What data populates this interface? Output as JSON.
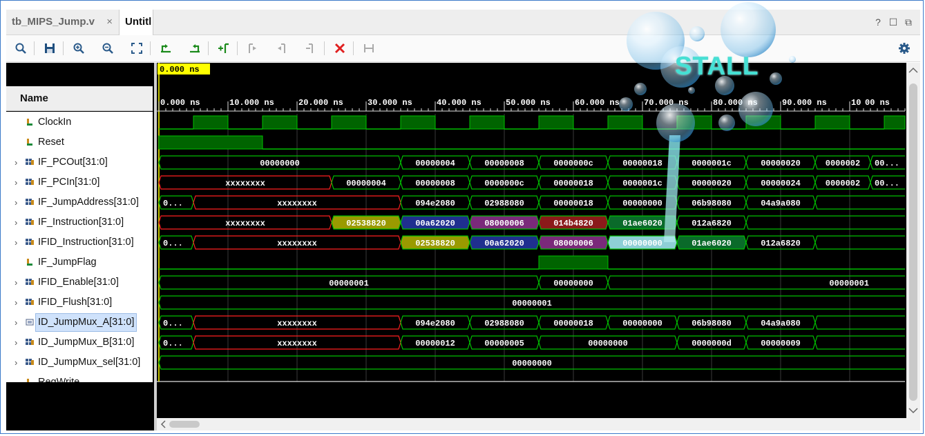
{
  "tabs": [
    {
      "label": "tb_MIPS_Jump.v",
      "close": "×"
    },
    {
      "label": "Untitl"
    }
  ],
  "window_buttons": [
    "?",
    "☐",
    "⧉"
  ],
  "toolbar": {
    "icons": [
      "search-icon",
      "save-icon",
      "zoom-in-icon",
      "zoom-out-icon",
      "zoom-fit-icon",
      "go-to-cursor-left-icon",
      "go-to-cursor-right-icon",
      "add-marker-icon",
      "previous-transition-icon",
      "next-transition-icon",
      "add-cursor-icon",
      "delete-icon",
      "swap-cursors-icon",
      "settings-icon"
    ]
  },
  "name_header": "Name",
  "cursor_time": "0.000 ns",
  "timescale": [
    "0.000 ns",
    "10.000 ns",
    "20.000 ns",
    "30.000 ns",
    "40.000 ns",
    "50.000 ns",
    "60.000 ns",
    "70.000 ns",
    "80.000 ns",
    "90.000 ns",
    "10",
    "00 ns"
  ],
  "overlay_text": "STALL",
  "colors": {
    "wave_green": "#00c000",
    "clock_fill": "#006400",
    "x_red": "#ff2020",
    "yellow": "#9a9a00",
    "blue": "#1f2f8f",
    "purple": "#7a2a7a",
    "red": "#8b1a1a",
    "green_bus": "#0a6a2a",
    "cyan": "#8ecfd6",
    "background": "#000000",
    "cursor_label": "#ffff00"
  },
  "signals": [
    {
      "name": "ClockIn",
      "kind": "bit",
      "expand": false,
      "segments": []
    },
    {
      "name": "Reset",
      "kind": "bit",
      "expand": false,
      "segments": []
    },
    {
      "name": "IF_PCOut[31:0]",
      "kind": "bus",
      "expand": true,
      "segments": [
        {
          "t0": 0,
          "t1": 35,
          "v": "00000000"
        },
        {
          "t0": 35,
          "t1": 45,
          "v": "00000004"
        },
        {
          "t0": 45,
          "t1": 55,
          "v": "00000008"
        },
        {
          "t0": 55,
          "t1": 65,
          "v": "0000000c"
        },
        {
          "t0": 65,
          "t1": 75,
          "v": "00000018"
        },
        {
          "t0": 75,
          "t1": 85,
          "v": "0000001c"
        },
        {
          "t0": 85,
          "t1": 95,
          "v": "00000020"
        },
        {
          "t0": 95,
          "t1": 103,
          "v": "0000002"
        },
        {
          "t0": 103,
          "t1": 108.2,
          "v": "00..."
        }
      ]
    },
    {
      "name": "IF_PCIn[31:0]",
      "kind": "bus",
      "expand": true,
      "segments": [
        {
          "t0": 0,
          "t1": 25,
          "v": "xxxxxxxx",
          "st": "x"
        },
        {
          "t0": 25,
          "t1": 35,
          "v": "00000004"
        },
        {
          "t0": 35,
          "t1": 45,
          "v": "00000008"
        },
        {
          "t0": 45,
          "t1": 55,
          "v": "0000000c"
        },
        {
          "t0": 55,
          "t1": 65,
          "v": "00000018"
        },
        {
          "t0": 65,
          "t1": 75,
          "v": "0000001c"
        },
        {
          "t0": 75,
          "t1": 85,
          "v": "00000020"
        },
        {
          "t0": 85,
          "t1": 95,
          "v": "00000024"
        },
        {
          "t0": 95,
          "t1": 103,
          "v": "0000002"
        },
        {
          "t0": 103,
          "t1": 108.2,
          "v": "00..."
        }
      ]
    },
    {
      "name": "IF_JumpAddress[31:0]",
      "kind": "bus",
      "expand": true,
      "segments": [
        {
          "t0": 0,
          "t1": 5,
          "v": "0..."
        },
        {
          "t0": 5,
          "t1": 35,
          "v": "xxxxxxxx",
          "st": "x"
        },
        {
          "t0": 35,
          "t1": 45,
          "v": "094e2080"
        },
        {
          "t0": 45,
          "t1": 55,
          "v": "02988080"
        },
        {
          "t0": 55,
          "t1": 65,
          "v": "00000018"
        },
        {
          "t0": 65,
          "t1": 75,
          "v": "00000000"
        },
        {
          "t0": 75,
          "t1": 85,
          "v": "06b98080"
        },
        {
          "t0": 85,
          "t1": 95,
          "v": "04a9a080"
        },
        {
          "t0": 95,
          "t1": 108.2,
          "v": ""
        }
      ]
    },
    {
      "name": "IF_Instruction[31:0]",
      "kind": "bus",
      "expand": true,
      "segments": [
        {
          "t0": 0,
          "t1": 25,
          "v": "xxxxxxxx",
          "st": "x"
        },
        {
          "t0": 25,
          "t1": 35,
          "v": "02538820",
          "st": "yellow"
        },
        {
          "t0": 35,
          "t1": 45,
          "v": "00a62020",
          "st": "blue"
        },
        {
          "t0": 45,
          "t1": 55,
          "v": "08000006",
          "st": "purple"
        },
        {
          "t0": 55,
          "t1": 65,
          "v": "014b4820",
          "st": "red"
        },
        {
          "t0": 65,
          "t1": 75,
          "v": "01ae6020",
          "st": "greenbus"
        },
        {
          "t0": 75,
          "t1": 85,
          "v": "012a6820"
        },
        {
          "t0": 85,
          "t1": 108.2,
          "v": ""
        }
      ]
    },
    {
      "name": "IFID_Instruction[31:0]",
      "kind": "bus",
      "expand": true,
      "segments": [
        {
          "t0": 0,
          "t1": 5,
          "v": "0..."
        },
        {
          "t0": 5,
          "t1": 35,
          "v": "xxxxxxxx",
          "st": "x"
        },
        {
          "t0": 35,
          "t1": 45,
          "v": "02538820",
          "st": "yellow"
        },
        {
          "t0": 45,
          "t1": 55,
          "v": "00a62020",
          "st": "blue"
        },
        {
          "t0": 55,
          "t1": 65,
          "v": "08000006",
          "st": "purple"
        },
        {
          "t0": 65,
          "t1": 75,
          "v": "00000000",
          "st": "cyan"
        },
        {
          "t0": 75,
          "t1": 85,
          "v": "01ae6020",
          "st": "greenbus"
        },
        {
          "t0": 85,
          "t1": 95,
          "v": "012a6820"
        },
        {
          "t0": 95,
          "t1": 108.2,
          "v": ""
        }
      ]
    },
    {
      "name": "IF_JumpFlag",
      "kind": "bit",
      "expand": false,
      "segments": []
    },
    {
      "name": "IFID_Enable[31:0]",
      "kind": "bus",
      "expand": true,
      "segments": [
        {
          "t0": 0,
          "t1": 55,
          "v": "00000001"
        },
        {
          "t0": 55,
          "t1": 65,
          "v": "00000000"
        },
        {
          "t0": 65,
          "t1": 108.2,
          "v": "00000001",
          "align": "right"
        }
      ]
    },
    {
      "name": "IFID_Flush[31:0]",
      "kind": "bus",
      "expand": true,
      "segments": [
        {
          "t0": 0,
          "t1": 108.2,
          "v": "00000001"
        }
      ]
    },
    {
      "name": "ID_JumpMux_A[31:0]",
      "kind": "bus",
      "expand": true,
      "selected": true,
      "segments": [
        {
          "t0": 0,
          "t1": 5,
          "v": "0..."
        },
        {
          "t0": 5,
          "t1": 35,
          "v": "xxxxxxxx",
          "st": "x"
        },
        {
          "t0": 35,
          "t1": 45,
          "v": "094e2080"
        },
        {
          "t0": 45,
          "t1": 55,
          "v": "02988080"
        },
        {
          "t0": 55,
          "t1": 65,
          "v": "00000018"
        },
        {
          "t0": 65,
          "t1": 75,
          "v": "00000000"
        },
        {
          "t0": 75,
          "t1": 85,
          "v": "06b98080"
        },
        {
          "t0": 85,
          "t1": 95,
          "v": "04a9a080"
        },
        {
          "t0": 95,
          "t1": 108.2,
          "v": ""
        }
      ]
    },
    {
      "name": "ID_JumpMux_B[31:0]",
      "kind": "bus",
      "expand": true,
      "segments": [
        {
          "t0": 0,
          "t1": 5,
          "v": "0..."
        },
        {
          "t0": 5,
          "t1": 35,
          "v": "xxxxxxxx",
          "st": "x"
        },
        {
          "t0": 35,
          "t1": 45,
          "v": "00000012"
        },
        {
          "t0": 45,
          "t1": 55,
          "v": "00000005"
        },
        {
          "t0": 55,
          "t1": 75,
          "v": "00000000"
        },
        {
          "t0": 75,
          "t1": 85,
          "v": "0000000d"
        },
        {
          "t0": 85,
          "t1": 95,
          "v": "00000009"
        },
        {
          "t0": 95,
          "t1": 108.2,
          "v": ""
        }
      ]
    },
    {
      "name": "ID_JumpMux_sel[31:0]",
      "kind": "bus",
      "expand": true,
      "segments": [
        {
          "t0": 0,
          "t1": 108.2,
          "v": "00000000"
        }
      ]
    },
    {
      "name": "RegWrite",
      "kind": "bit",
      "expand": false,
      "segments": []
    }
  ]
}
